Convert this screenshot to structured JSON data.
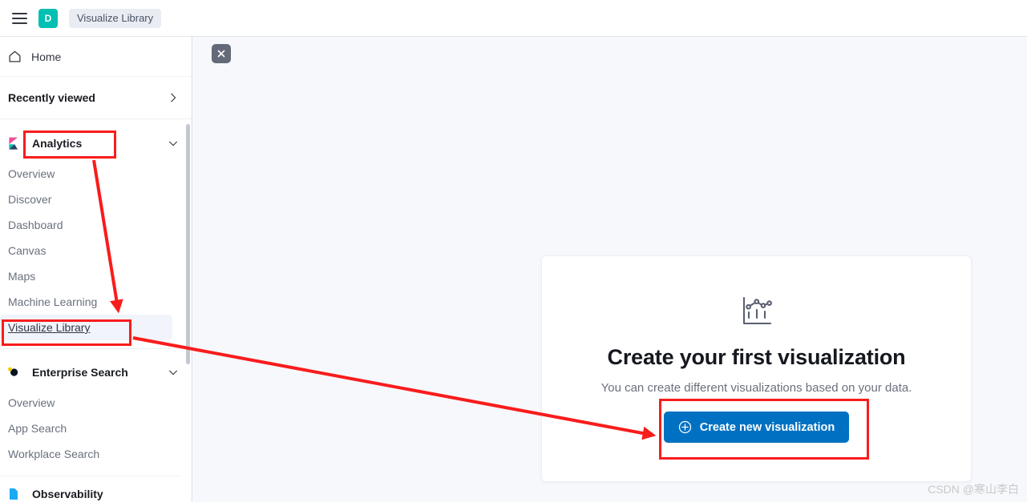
{
  "header": {
    "menu_icon": "hamburger-icon",
    "avatar_initial": "D",
    "breadcrumb": "Visualize Library"
  },
  "sidebar": {
    "home": {
      "label": "Home",
      "icon": "home-icon"
    },
    "recently_viewed": {
      "label": "Recently viewed",
      "icon": "chevron-right-icon"
    },
    "sections": [
      {
        "label": "Analytics",
        "icon": "kibana-logo-icon",
        "expanded": true,
        "items": [
          {
            "label": "Overview",
            "selected": false
          },
          {
            "label": "Discover",
            "selected": false
          },
          {
            "label": "Dashboard",
            "selected": false
          },
          {
            "label": "Canvas",
            "selected": false
          },
          {
            "label": "Maps",
            "selected": false
          },
          {
            "label": "Machine Learning",
            "selected": false
          },
          {
            "label": "Visualize Library",
            "selected": true
          }
        ]
      },
      {
        "label": "Enterprise Search",
        "icon": "enterprise-search-icon",
        "expanded": true,
        "items": [
          {
            "label": "Overview",
            "selected": false
          },
          {
            "label": "App Search",
            "selected": false
          },
          {
            "label": "Workplace Search",
            "selected": false
          }
        ]
      },
      {
        "label": "Observability",
        "icon": "observability-icon",
        "expanded": false,
        "items": []
      }
    ]
  },
  "main": {
    "close_button_icon": "close-icon",
    "empty_state": {
      "icon": "visualization-chart-icon",
      "title": "Create your first visualization",
      "subtitle": "You can create different visualizations based on your data.",
      "button_label": "Create new visualization",
      "button_icon": "plus-circle-icon",
      "button_color": "#0071c2"
    }
  },
  "annotations": {
    "color": "#f91c1c",
    "boxes": [
      "analytics-section",
      "visualize-library-item",
      "create-new-visualization-button"
    ],
    "arrows": [
      "analytics-to-visualize-library",
      "visualize-library-to-create-button"
    ]
  },
  "watermark": "CSDN @寒山李白"
}
